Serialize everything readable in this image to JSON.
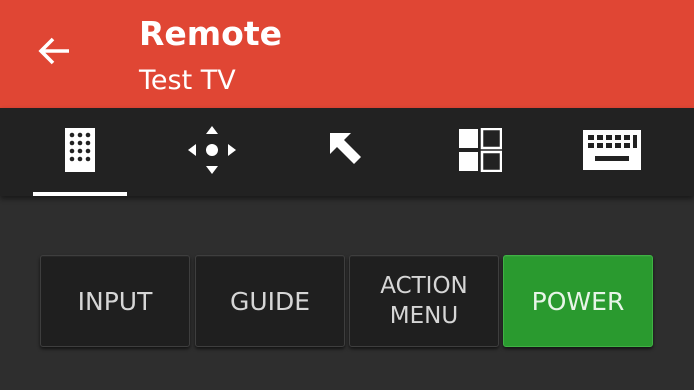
{
  "appbar": {
    "title": "Remote",
    "subtitle": "Test TV",
    "background_color": "#e04634",
    "back_icon": "arrow-left-icon"
  },
  "tabs": [
    {
      "icon": "remote-control-icon",
      "selected": true
    },
    {
      "icon": "dpad-icon",
      "selected": false
    },
    {
      "icon": "pointer-arrow-icon",
      "selected": false
    },
    {
      "icon": "apps-grid-icon",
      "selected": false
    },
    {
      "icon": "keyboard-icon",
      "selected": false
    }
  ],
  "buttons": {
    "input": "INPUT",
    "guide": "GUIDE",
    "action_menu_line1": "ACTION",
    "action_menu_line2": "MENU",
    "power": "POWER",
    "power_color": "#2a9a2f"
  }
}
